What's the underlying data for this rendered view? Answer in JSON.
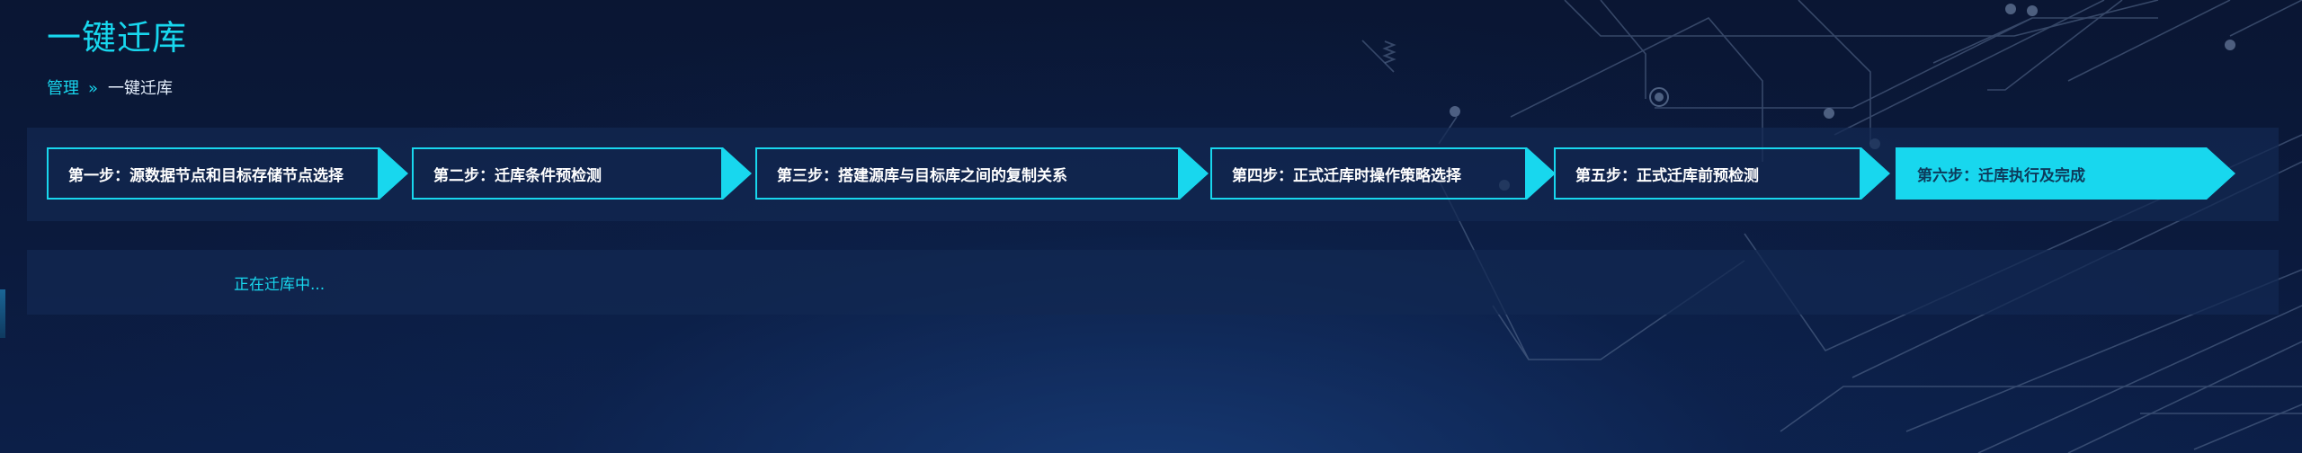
{
  "header": {
    "title": "一键迁库",
    "breadcrumb": {
      "parent": "管理",
      "separator": "»",
      "current": "一键迁库"
    }
  },
  "steps": [
    {
      "label": "第一步：源数据节点和目标存储节点选择",
      "active": false
    },
    {
      "label": "第二步：迁库条件预检测",
      "active": false
    },
    {
      "label": "第三步：搭建源库与目标库之间的复制关系",
      "active": false
    },
    {
      "label": "第四步：正式迁库时操作策略选择",
      "active": false
    },
    {
      "label": "第五步：正式迁库前预检测",
      "active": false
    },
    {
      "label": "第六步：迁库执行及完成",
      "active": true
    }
  ],
  "status": {
    "message": "正在迁库中..."
  },
  "colors": {
    "accent": "#18d7ee",
    "background": "#0b1a3d",
    "panel": "#12285a",
    "text": "#ffffff"
  }
}
